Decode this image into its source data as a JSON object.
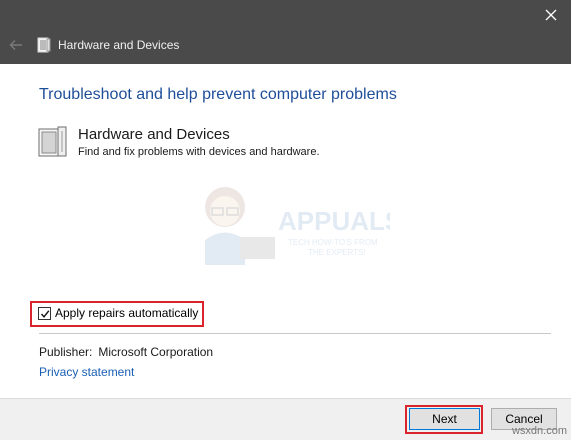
{
  "window": {
    "title": "Hardware and Devices",
    "close_icon": "close-icon",
    "back_icon": "back-arrow-icon"
  },
  "content": {
    "heading": "Troubleshoot and help prevent computer problems",
    "troubleshooter": {
      "name": "Hardware and Devices",
      "description": "Find and fix problems with devices and hardware.",
      "icon": "hardware-device-icon"
    },
    "apply_repairs": {
      "label": "Apply repairs automatically",
      "checked": true
    },
    "publisher_label": "Publisher:",
    "publisher_value": "Microsoft Corporation",
    "privacy_link": "Privacy statement"
  },
  "footer": {
    "next_label": "Next",
    "cancel_label": "Cancel"
  },
  "watermark": {
    "brand": "APPUALS",
    "tagline_1": "TECH HOW-TO'S FROM",
    "tagline_2": "THE EXPERTS!",
    "site": "wsxdn.com"
  },
  "colors": {
    "titlebar": "#4a4a4a",
    "heading": "#1f4e99",
    "link": "#1a5fb4",
    "highlight": "#d9232d",
    "accent": "#0078d7"
  }
}
